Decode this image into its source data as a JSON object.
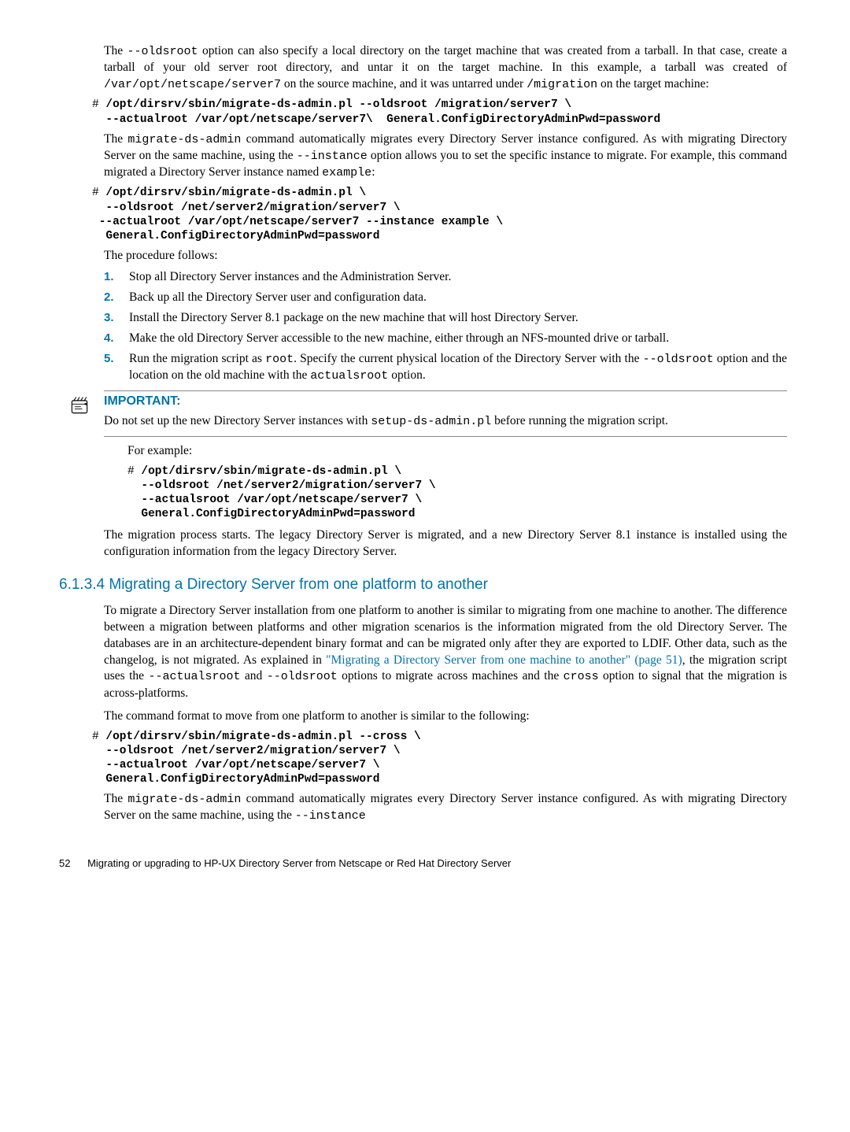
{
  "para1_a": "The ",
  "para1_code1": "--oldsroot",
  "para1_b": " option can also specify a local directory on the target machine that was created from a tarball. In that case, create a tarball of your old server root directory, and untar it on the target machine. In this example, a tarball was created of ",
  "para1_code2": "/var/opt/netscape/server7",
  "para1_c": " on the source machine, and it was untarred under ",
  "para1_code3": "/migration",
  "para1_d": " on the target machine:",
  "code1_prompt": "# ",
  "code1": "/opt/dirsrv/sbin/migrate-ds-admin.pl --oldsroot /migration/server7 \\\n  --actualroot /var/opt/netscape/server7\\  General.ConfigDirectoryAdminPwd=password",
  "para2_a": "The ",
  "para2_code1": "migrate-ds-admin",
  "para2_b": " command automatically migrates every Directory Server instance configured. As with migrating Directory Server on the same machine, using the ",
  "para2_code2": "--instance",
  "para2_c": " option allows you to set the specific instance to migrate. For example, this command migrated a Directory Server instance named ",
  "para2_code3": "example",
  "para2_d": ":",
  "code2_prompt": "# ",
  "code2": "/opt/dirsrv/sbin/migrate-ds-admin.pl \\\n  --oldsroot /net/server2/migration/server7 \\\n --actualroot /var/opt/netscape/server7 --instance example \\\n  General.ConfigDirectoryAdminPwd=password",
  "para3": "The procedure follows:",
  "steps": {
    "1": {
      "num": "1.",
      "text": "Stop all Directory Server instances and the Administration Server."
    },
    "2": {
      "num": "2.",
      "text": "Back up all the Directory Server user and configuration data."
    },
    "3": {
      "num": "3.",
      "text": "Install the Directory Server 8.1 package on the new machine that will host Directory Server."
    },
    "4": {
      "num": "4.",
      "text": "Make the old Directory Server accessible to the new machine, either through an NFS-mounted drive or tarball."
    },
    "5": {
      "num": "5.",
      "a": "Run the migration script as ",
      "code1": "root",
      "b": ". Specify the current physical location of the Directory Server with the ",
      "code2": "--oldsroot",
      "c": " option and the location on the old machine with the ",
      "code3": "actualsroot",
      "d": " option."
    }
  },
  "important": {
    "heading": "IMPORTANT:",
    "a": "Do not set up the new Directory Server instances with ",
    "code": "setup-ds-admin.pl",
    "b": " before running the migration script."
  },
  "for_example": "For example:",
  "code3_prompt": "# ",
  "code3": "/opt/dirsrv/sbin/migrate-ds-admin.pl \\\n  --oldsroot /net/server2/migration/server7 \\\n  --actualsroot /var/opt/netscape/server7 \\\n  General.ConfigDirectoryAdminPwd=password",
  "para4": "The migration process starts. The legacy Directory Server is migrated, and a new Directory Server 8.1 instance is installed using the configuration information from the legacy Directory Server.",
  "section_heading": "6.1.3.4 Migrating a Directory Server from one platform to another",
  "para5_a": "To migrate a Directory Server installation from one platform to another is similar to migrating from one machine to another. The difference between a migration between platforms and other migration scenarios is the information migrated from the old Directory Server. The databases are in an architecture-dependent binary format and can be migrated only after they are exported to LDIF. Other data, such as the changelog, is not migrated. As explained in ",
  "para5_link": "\"Migrating a Directory Server from one machine to another\" (page 51)",
  "para5_b": ", the migration script uses the ",
  "para5_code1": "--actualsroot",
  "para5_c": " and ",
  "para5_code2": "--oldsroot",
  "para5_d": " options to migrate across machines and the ",
  "para5_code3": "cross",
  "para5_e": " option to signal that the migration is across-platforms.",
  "para6": "The command format to move from one platform to another is similar to the following:",
  "code4_prompt": "# ",
  "code4": "/opt/dirsrv/sbin/migrate-ds-admin.pl --cross \\\n  --oldsroot /net/server2/migration/server7 \\\n  --actualroot /var/opt/netscape/server7 \\\n  General.ConfigDirectoryAdminPwd=password",
  "para7_a": "The ",
  "para7_code1": "migrate-ds-admin",
  "para7_b": " command automatically migrates every Directory Server instance configured. As with migrating Directory Server on the same machine, using the ",
  "para7_code2": "--instance",
  "footer": {
    "page": "52",
    "title": "Migrating or upgrading to HP-UX Directory Server from Netscape or Red Hat Directory Server"
  }
}
